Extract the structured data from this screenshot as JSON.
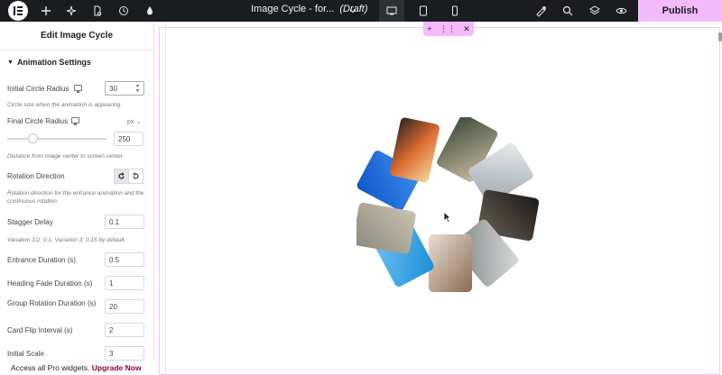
{
  "topbar": {
    "logo": "elementor-logo",
    "title": "Image Cycle - for...",
    "status": "(Draft)",
    "publish_label": "Publish",
    "colors": {
      "bar": "#1a1c20",
      "publish": "#f3bafd"
    }
  },
  "panel": {
    "title": "Edit Image Cycle",
    "section": "Animation Settings",
    "fields": {
      "initial_radius": {
        "label": "Initial Circle Radius",
        "value": "30",
        "hint": "Circle size when the animation is appearing."
      },
      "final_radius": {
        "label": "Final Circle Radius",
        "unit": "px",
        "value": "250",
        "hint": "Distance from image center to screen center."
      },
      "rotation": {
        "label": "Rotation Direction",
        "hint": "Rotation direction for the entrance animation and the continuous rotation."
      },
      "stagger": {
        "label": "Stagger Delay",
        "value": "0.1",
        "hint": "Variation 1/2: 0.1, Variation 3: 0.15 by default."
      },
      "entrance": {
        "label": "Entrance Duration (s)",
        "value": "0.5"
      },
      "heading_fade": {
        "label": "Heading Fade Duration (s)",
        "value": "1"
      },
      "group_rotation": {
        "label": "Group Rotation Duration (s)",
        "value": "20"
      },
      "card_flip": {
        "label": "Card Flip Interval (s)",
        "value": "2"
      },
      "initial_scale": {
        "label": "Initial Scale",
        "value": "3"
      }
    },
    "promo": {
      "text": "Access all Pro widgets.",
      "link": "Upgrade Now"
    }
  }
}
